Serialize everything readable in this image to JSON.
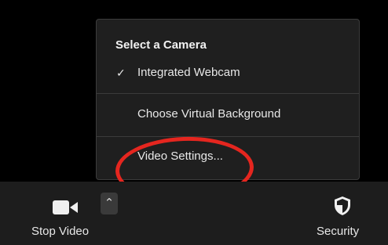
{
  "camera_menu": {
    "header": "Select a Camera",
    "items": [
      {
        "label": "Integrated Webcam",
        "checked": true,
        "check_icon": "checkmark-icon"
      },
      {
        "label": "Choose Virtual Background"
      },
      {
        "label": "Video Settings..."
      }
    ]
  },
  "toolbar": {
    "stop_video_label": "Stop Video",
    "security_label": "Security",
    "video_icon": "camera-icon",
    "chevron_icon": "chevron-up-icon",
    "security_icon": "shield-icon"
  },
  "colors": {
    "background": "#000000",
    "menu_background": "#1f1f1f",
    "toolbar_background": "#1d1d1d",
    "highlight": "#e5261f",
    "text": "#e8e8e8"
  }
}
